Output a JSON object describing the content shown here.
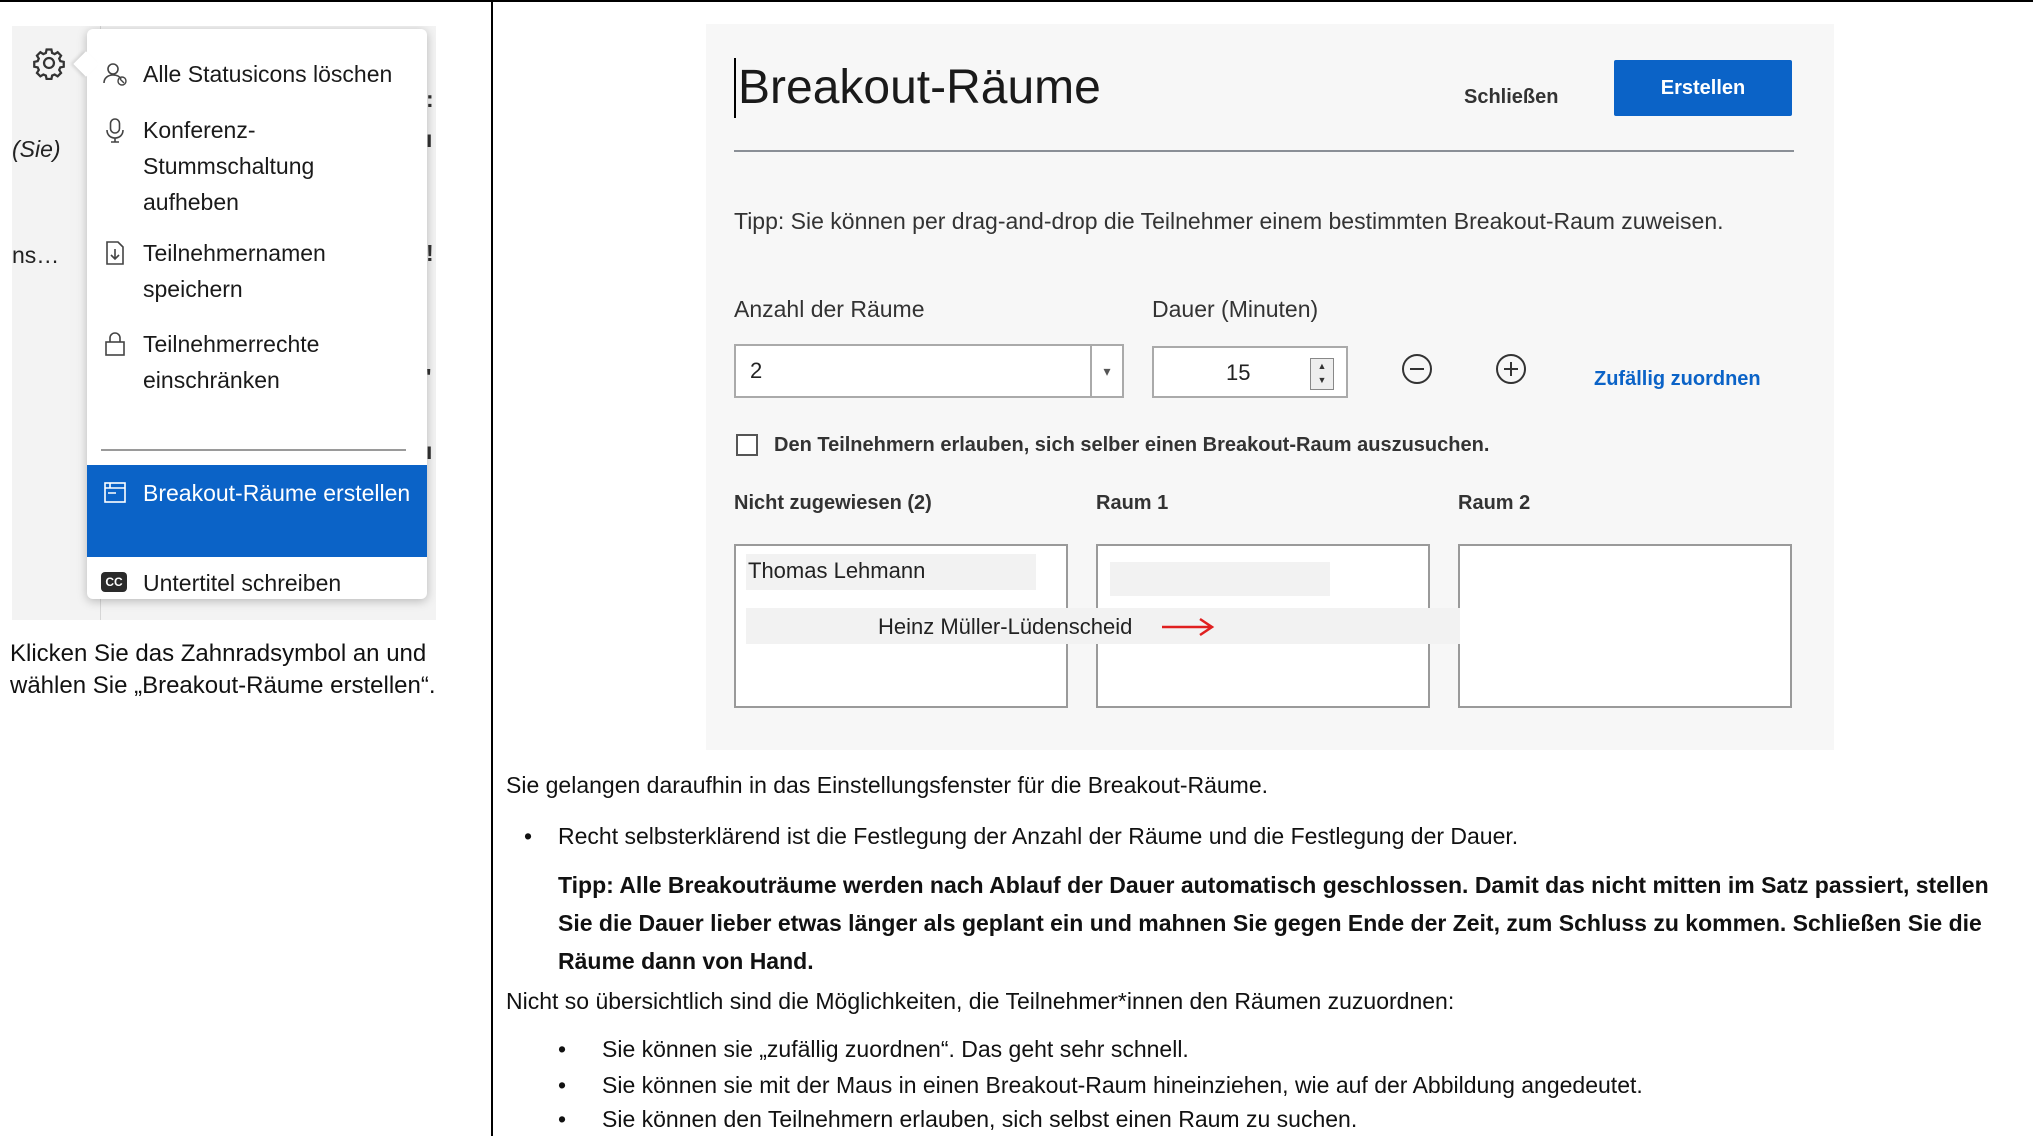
{
  "menu": {
    "items": [
      {
        "label": "Alle Statusicons löschen"
      },
      {
        "label": "Konferenz-Stummschaltung aufheben"
      },
      {
        "label": "Teilnehmernamen speichern"
      },
      {
        "label": "Teilnehmerrechte einschränken"
      },
      {
        "label": "Breakout-Räume erstellen"
      },
      {
        "label": "Untertitel schreiben"
      }
    ],
    "partial_sie": "(Sie)",
    "partial_ns": "ns…",
    "cc_badge": "CC"
  },
  "left_caption": "Klicken Sie das Zahnradsymbol an und wählen Sie „Breakout-Räume erstellen“.",
  "dialog": {
    "title": "Breakout-Räume",
    "close_label": "Schließen",
    "create_label": "Erstellen",
    "tip": "Tipp: Sie können per drag-and-drop die Teilnehmer einem bestimmten Breakout-Raum zuweisen.",
    "rooms_label": "Anzahl der Räume",
    "duration_label": "Dauer (Minuten)",
    "rooms_value": "2",
    "duration_value": "15",
    "random_label": "Zufällig zuordnen",
    "allow_label": "Den Teilnehmern erlauben, sich selber einen Breakout-Raum auszusuchen.",
    "columns": [
      "Nicht zugewiesen (2)",
      "Raum 1",
      "Raum 2"
    ],
    "participant_1": "Thomas Lehmann",
    "participant_2": "Heinz Müller-Lüdenscheid"
  },
  "body": {
    "intro": "Sie gelangen daraufhin in das Einstellungsfenster für die Breakout-Räume.",
    "bullet_1": "Recht selbsterklärend ist die Festlegung der Anzahl der Räume und die Festlegung der Dauer.",
    "tip_bold": "Tipp: Alle Breakouträume werden nach Ablauf der Dauer automatisch geschlossen. Damit das nicht mitten im Satz passiert, stellen Sie die Dauer lieber etwas länger als geplant ein und mahnen Sie gegen Ende der Zeit, zum Schluss zu kommen. Schließen Sie die Räume dann von Hand.",
    "assign_intro": "Nicht so übersichtlich sind die Möglichkeiten, die Teilnehmer*innen den Räumen zuzuordnen:",
    "sub_bullets": [
      "Sie können sie „zufällig zuordnen“.  Das geht sehr schnell.",
      "Sie können sie mit der Maus in einen Breakout-Raum hineinziehen, wie auf der Abbildung angedeutet.",
      "Sie können den Teilnehmern erlauben, sich selbst einen Raum zu suchen."
    ]
  },
  "colors": {
    "accent_blue": "#0b63c7",
    "arrow_red": "#e02020"
  }
}
